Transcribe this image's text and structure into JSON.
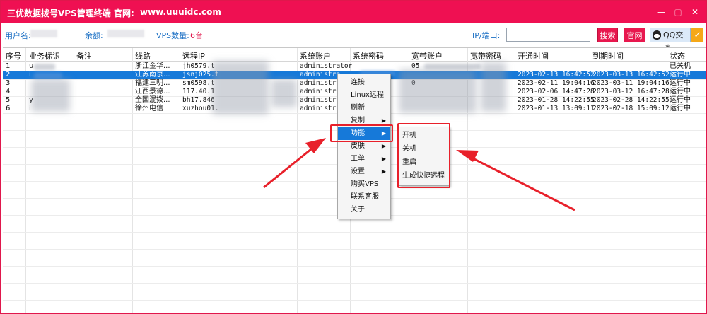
{
  "app": {
    "title": "三优数据拨号VPS管理终端",
    "site_label": "官网:",
    "site_url": "www.uuuidc.com",
    "window_buttons": {
      "close": "✕",
      "maximize": "▢",
      "minimize": "—"
    }
  },
  "infobar": {
    "user_label": "用户名:",
    "balance_label": "余额:",
    "vps_count_label": "VPS数量:",
    "vps_count_value": "6台",
    "ip_label": "IP/端口:",
    "ip_value": "",
    "search_button": "搜索",
    "site_button": "官网",
    "qq_button": "QQ交谈",
    "check_icon": "✓"
  },
  "table": {
    "columns": [
      "序号",
      "业务标识",
      "备注",
      "线路",
      "远程IP",
      "系统账户",
      "系统密码",
      "宽带账户",
      "宽带密码",
      "开通时间",
      "到期时间",
      "状态"
    ],
    "rows": [
      {
        "no": "1",
        "biz": "u",
        "note": "",
        "line": "浙江金华...",
        "ip": "jh0579.t",
        "account": "administrator",
        "password": "",
        "bb_account": "05",
        "bb_password": "",
        "open": "",
        "expire": "",
        "status": "已关机"
      },
      {
        "no": "2",
        "biz": "i",
        "note": "",
        "line": "江苏南京...",
        "ip": "jsnj025.t",
        "account": "administra",
        "password": "",
        "bb_account": "",
        "bb_password": "",
        "open": "2023-02-13 16:42:52",
        "expire": "2023-03-13 16:42:52",
        "status": "运行中"
      },
      {
        "no": "3",
        "biz": "",
        "note": "",
        "line": "福建三明...",
        "ip": "sm0598.t",
        "account": "administra",
        "password": "",
        "bb_account": "0",
        "bb_password": "",
        "open": "2023-02-11 19:04:16",
        "expire": "2023-03-11 19:04:16",
        "status": "运行中"
      },
      {
        "no": "4",
        "biz": "",
        "note": "",
        "line": "江西景德...",
        "ip": "117.40.1",
        "account": "administra",
        "password": "",
        "bb_account": "",
        "bb_password": "",
        "open": "2023-02-06 14:47:28",
        "expire": "2023-03-12 16:47:28",
        "status": "运行中"
      },
      {
        "no": "5",
        "biz": "y",
        "note": "",
        "line": "全国混拨...",
        "ip": "bh17.846",
        "account": "administra",
        "password": "",
        "bb_account": "",
        "bb_password": "",
        "open": "2023-01-28 14:22:55",
        "expire": "2023-02-28 14:22:55",
        "status": "运行中"
      },
      {
        "no": "6",
        "biz": "i",
        "note": "",
        "line": "徐州电信",
        "ip": "xuzhou01.",
        "account": "administra",
        "password": "",
        "bb_account": "",
        "bb_password": "",
        "open": "2023-01-13 13:09:11",
        "expire": "2023-02-18 15:09:12",
        "status": "运行中"
      }
    ]
  },
  "context_menu": {
    "items": [
      {
        "label": "连接",
        "submenu": false
      },
      {
        "label": "Linux远程",
        "submenu": false
      },
      {
        "label": "刷新",
        "submenu": false
      },
      {
        "label": "复制",
        "submenu": true
      },
      {
        "label": "功能",
        "submenu": true,
        "highlighted": true
      },
      {
        "label": "皮肤",
        "submenu": true
      },
      {
        "label": "工单",
        "submenu": true
      },
      {
        "label": "设置",
        "submenu": true
      },
      {
        "label": "购买VPS",
        "submenu": false
      },
      {
        "label": "联系客服",
        "submenu": false
      },
      {
        "label": "关于",
        "submenu": false
      }
    ],
    "submenu_glyph": "▶"
  },
  "function_submenu": {
    "items": [
      "开机",
      "关机",
      "重启",
      "生成快捷远程"
    ]
  },
  "colors": {
    "brand": "#ef1052",
    "selection": "#1679d9",
    "label_blue": "#1a6fc4",
    "annotation_red": "#e8202a"
  }
}
